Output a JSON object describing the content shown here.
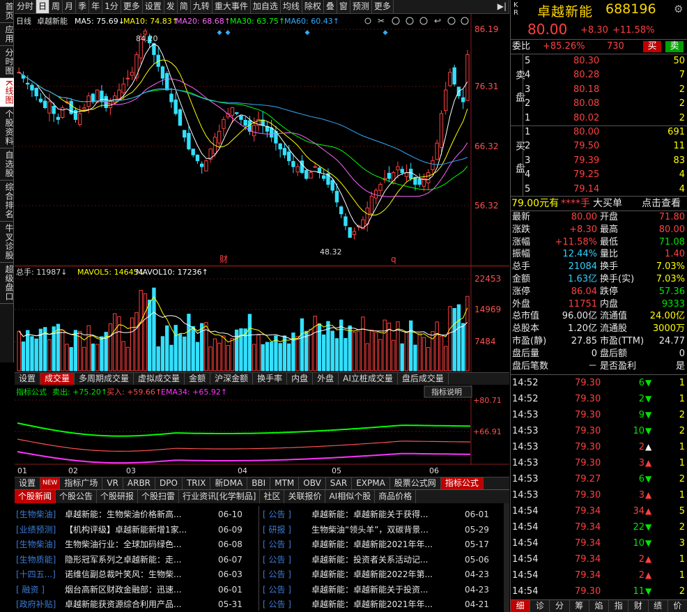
{
  "left_tabs": [
    "首页",
    "应用",
    "分时图",
    "K线图",
    "个股资料",
    "自选股",
    "综合排名",
    "牛叉诊股",
    "超级盘口"
  ],
  "left_active": 3,
  "toolbar": [
    "分时",
    "日",
    "周",
    "月",
    "季",
    "年",
    "1分",
    "更多",
    "设置",
    "发",
    "简",
    "九转",
    "重大事件",
    "加自选",
    "均线",
    "除权",
    "叠",
    "窗",
    "预测",
    "更多"
  ],
  "toolbar_active": 1,
  "chart": {
    "legend": {
      "name": "日线",
      "stock": "卓越新能",
      "ma5": "MA5: 75.69↓",
      "ma10": "MA10: 74.83↑",
      "ma20": "MA20: 68.68↑",
      "ma30": "MA30: 63.75↑",
      "ma60": "MA60: 60.43↑"
    },
    "ylabels": [
      "86.19",
      "76.31",
      "66.32",
      "56.32"
    ],
    "high_label": "84.20",
    "low_label": "48.32",
    "markers": [
      "财",
      "q"
    ]
  },
  "volume": {
    "legend": {
      "total": "总手: 11987↓",
      "mavol5": "MAVOL5: 14645↓",
      "mavol10": "MAVOL10: 17236↑"
    },
    "ylabels": [
      "22453",
      "14969",
      "7484"
    ]
  },
  "sub_tabs": [
    "设置",
    "成交量",
    "多周期成交量",
    "虚拟成交量",
    "金额",
    "沪深金额",
    "换手率",
    "内盘",
    "外盘",
    "AI立桩成交量",
    "盘后成交量"
  ],
  "sub_active": 1,
  "indicator": {
    "legend": {
      "name": "指标公式",
      "sell": "卖出: +75.20↑",
      "buy": "买入: +59.66↑",
      "ema": "EMA34: +65.92↑"
    },
    "help": "指标说明",
    "ylabels": [
      "+80.71",
      "+66.91"
    ],
    "xlabels": [
      "01",
      "02",
      "03",
      "04",
      "05",
      "06"
    ]
  },
  "ind_tabs": [
    "设置",
    "NEW",
    "指标广场",
    "VR",
    "ARBR",
    "DPO",
    "TRIX",
    "新DMA",
    "BBI",
    "MTM",
    "OBV",
    "SAR",
    "EXPMA",
    "股票公式网",
    "指标公式"
  ],
  "news_tabs": [
    "个股新闻",
    "个股公告",
    "个股研报",
    "个股扫雷",
    "行业资讯[化学制品]",
    "社区",
    "关联报价",
    "AI相似个股",
    "商品价格"
  ],
  "news_left": [
    {
      "tag": "[生物柴油]",
      "title": "卓越新能：生物柴油价格新高...",
      "date": "06-10"
    },
    {
      "tag": "[业绩预测]",
      "title": "【机构评级】卓越新能新增1家...",
      "date": "06-09"
    },
    {
      "tag": "[生物柴油]",
      "title": "生物柴油行业：全球加码绿色...",
      "date": "06-08"
    },
    {
      "tag": "[生物质能]",
      "title": "隐形冠军系列之卓越新能：走...",
      "date": "06-07"
    },
    {
      "tag": "[十四五...]",
      "title": "诺维信副总裁叶笑风：生物柴...",
      "date": "06-03"
    },
    {
      "tag": "[  融资  ]",
      "title": "烟台高新区财政金融部：迅速...",
      "date": "06-01"
    },
    {
      "tag": "[政府补贴]",
      "title": "卓越新能获资源综合利用产品...",
      "date": "05-31"
    }
  ],
  "news_right": [
    {
      "tag": "[  公告  ]",
      "title": "卓越新能：卓越新能关于获得...",
      "date": "06-01"
    },
    {
      "tag": "[  研报  ]",
      "title": "生物柴油“领头羊”，双碳背景...",
      "date": "05-29"
    },
    {
      "tag": "[  公告  ]",
      "title": "卓越新能：卓越新能2021年年...",
      "date": "05-17"
    },
    {
      "tag": "[  公告  ]",
      "title": "卓越新能：投资者关系活动记...",
      "date": "05-06"
    },
    {
      "tag": "[  公告  ]",
      "title": "卓越新能：卓越新能2022年第...",
      "date": "04-23"
    },
    {
      "tag": "[  公告  ]",
      "title": "卓越新能：卓越新能关于投资...",
      "date": "04-23"
    },
    {
      "tag": "[  公告  ]",
      "title": "卓越新能：卓越新能2021年年...",
      "date": "04-21"
    }
  ],
  "quote": {
    "kr": "K R",
    "name": "卓越新能",
    "code": "688196",
    "price": "80.00",
    "change": "+8.30",
    "pct": "+11.58%",
    "weibi_label": "委比",
    "weibi": "+85.26%",
    "weibi_vol": "730",
    "buy_btn": "买",
    "sell_btn": "卖",
    "sell_label": "卖盘",
    "buy_label": "买盘",
    "asks": [
      {
        "n": "5",
        "p": "80.30",
        "v": "50"
      },
      {
        "n": "4",
        "p": "80.28",
        "v": "7"
      },
      {
        "n": "3",
        "p": "80.18",
        "v": "2"
      },
      {
        "n": "2",
        "p": "80.08",
        "v": "2"
      },
      {
        "n": "1",
        "p": "80.02",
        "v": "2"
      }
    ],
    "bids": [
      {
        "n": "1",
        "p": "80.00",
        "v": "691"
      },
      {
        "n": "2",
        "p": "79.50",
        "v": "11"
      },
      {
        "n": "3",
        "p": "79.39",
        "v": "83"
      },
      {
        "n": "4",
        "p": "79.25",
        "v": "4"
      },
      {
        "n": "5",
        "p": "79.14",
        "v": "4"
      }
    ],
    "bigorder": {
      "price": "79.00元有",
      "hand": "****手",
      "big": "大买单",
      "check": "点击查看"
    },
    "stats": [
      [
        "最新",
        "80.00",
        "开盘",
        "71.80"
      ],
      [
        "涨跌",
        "+8.30",
        "最高",
        "80.00"
      ],
      [
        "涨幅",
        "+11.58%",
        "最低",
        "71.08"
      ],
      [
        "振幅",
        "12.44%",
        "量比",
        "1.40"
      ],
      [
        "总手",
        "21084",
        "换手",
        "7.03%"
      ],
      [
        "金额",
        "1.63亿",
        "换手(实)",
        "7.03%"
      ],
      [
        "涨停",
        "86.04",
        "跌停",
        "57.36"
      ],
      [
        "外盘",
        "11751",
        "内盘",
        "9333"
      ],
      [
        "总市值",
        "96.00亿",
        "流通值",
        "24.00亿"
      ],
      [
        "总股本",
        "1.20亿",
        "流通股",
        "3000万"
      ],
      [
        "市盈(静)",
        "27.85",
        "市盈(TTM)",
        "24.77"
      ],
      [
        "盘后量",
        "0",
        "盘后额",
        "0"
      ],
      [
        "盘后笔数",
        "－",
        "是否盈利",
        "是"
      ]
    ],
    "ticks": [
      {
        "t": "14:52",
        "p": "79.30",
        "v": "6",
        "d": "down",
        "n": "1"
      },
      {
        "t": "14:52",
        "p": "79.30",
        "v": "2",
        "d": "down",
        "n": "1"
      },
      {
        "t": "14:53",
        "p": "79.30",
        "v": "9",
        "d": "down",
        "n": "2"
      },
      {
        "t": "14:53",
        "p": "79.30",
        "v": "10",
        "d": "down",
        "n": "2"
      },
      {
        "t": "14:53",
        "p": "79.30",
        "v": "2",
        "d": "up",
        "n": "1"
      },
      {
        "t": "14:53",
        "p": "79.30",
        "v": "3",
        "d": "up",
        "n": "1"
      },
      {
        "t": "14:53",
        "p": "79.27",
        "v": "6",
        "d": "down",
        "n": "2"
      },
      {
        "t": "14:53",
        "p": "79.30",
        "v": "3",
        "d": "up",
        "n": "1"
      },
      {
        "t": "14:54",
        "p": "79.34",
        "v": "34",
        "d": "up",
        "n": "5"
      },
      {
        "t": "14:54",
        "p": "79.34",
        "v": "22",
        "d": "down",
        "n": "2"
      },
      {
        "t": "14:54",
        "p": "79.34",
        "v": "10",
        "d": "down",
        "n": "3"
      },
      {
        "t": "14:54",
        "p": "79.34",
        "v": "2",
        "d": "up",
        "n": "1"
      },
      {
        "t": "14:54",
        "p": "79.34",
        "v": "2",
        "d": "up",
        "n": "1"
      },
      {
        "t": "14:54",
        "p": "79.30",
        "v": "11",
        "d": "down",
        "n": "2"
      }
    ],
    "bottom_tabs": [
      "细",
      "诊",
      "分",
      "筹",
      "焰",
      "指",
      "财",
      "绩",
      "价"
    ]
  }
}
